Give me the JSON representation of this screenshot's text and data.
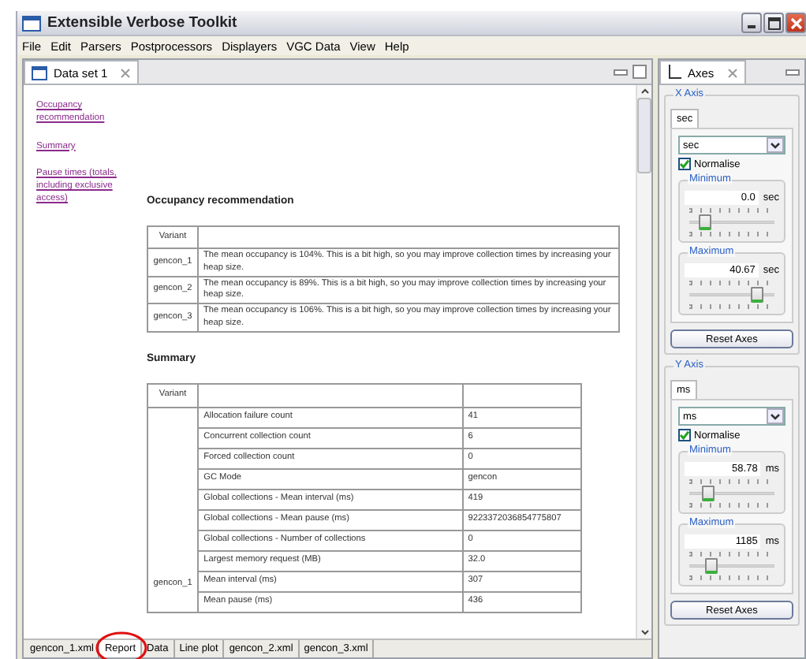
{
  "window": {
    "title": "Extensible Verbose Toolkit"
  },
  "menu": [
    "File",
    "Edit",
    "Parsers",
    "Postprocessors",
    "Displayers",
    "VGC Data",
    "View",
    "Help"
  ],
  "editor": {
    "tab": "Data set 1",
    "links": [
      "Occupancy recommendation",
      "Summary",
      "Pause times (totals, including exclusive access)"
    ],
    "occupancy": {
      "heading": "Occupancy recommendation",
      "column": "Variant",
      "rows": [
        {
          "variant": "gencon_1",
          "text": "The mean occupancy is 104%. This is a bit high, so you may improve collection times by increasing your heap size."
        },
        {
          "variant": "gencon_2",
          "text": "The mean occupancy is 89%. This is a bit high, so you may improve collection times by increasing your heap size."
        },
        {
          "variant": "gencon_3",
          "text": "The mean occupancy is 106%. This is a bit high, so you may improve collection times by increasing your heap size."
        }
      ]
    },
    "summary": {
      "heading": "Summary",
      "column": "Variant",
      "variant": "gencon_1",
      "rows": [
        {
          "label": "Allocation failure count",
          "value": "41"
        },
        {
          "label": "Concurrent collection count",
          "value": "6"
        },
        {
          "label": "Forced collection count",
          "value": "0"
        },
        {
          "label": "GC Mode",
          "value": "gencon"
        },
        {
          "label": "Global collections - Mean interval (ms)",
          "value": "419"
        },
        {
          "label": "Global collections - Mean pause (ms)",
          "value": "9223372036854775807"
        },
        {
          "label": "Global collections - Number of collections",
          "value": "0"
        },
        {
          "label": "Largest memory request (MB)",
          "value": "32.0"
        },
        {
          "label": "Mean interval (ms)",
          "value": "307"
        },
        {
          "label": "Mean pause (ms)",
          "value": "436"
        }
      ]
    },
    "bottom_tabs": [
      {
        "label": "gencon_1.xml",
        "selected": false
      },
      {
        "label": "Report",
        "selected": true
      },
      {
        "label": "Data",
        "selected": false
      },
      {
        "label": "Line plot",
        "selected": false
      },
      {
        "label": "gencon_2.xml",
        "selected": false
      },
      {
        "label": "gencon_3.xml",
        "selected": false
      }
    ]
  },
  "axes": {
    "tab": "Axes",
    "groups": [
      {
        "title": "X Axis",
        "tab": "sec",
        "unit": "sec",
        "normalise": true,
        "normalise_label": "Normalise",
        "minimum": {
          "label": "Minimum",
          "value": "0.0",
          "unit": "sec",
          "level": 0.17
        },
        "maximum": {
          "label": "Maximum",
          "value": "40.67",
          "unit": "sec",
          "level": 0.78
        },
        "reset": "Reset Axes"
      },
      {
        "title": "Y Axis",
        "tab": "ms",
        "unit": "ms",
        "normalise": true,
        "normalise_label": "Normalise",
        "minimum": {
          "label": "Minimum",
          "value": "58.78",
          "unit": "ms",
          "level": 0.2
        },
        "maximum": {
          "label": "Maximum",
          "value": "1185",
          "unit": "ms",
          "level": 0.24
        },
        "reset": "Reset Axes"
      }
    ]
  }
}
